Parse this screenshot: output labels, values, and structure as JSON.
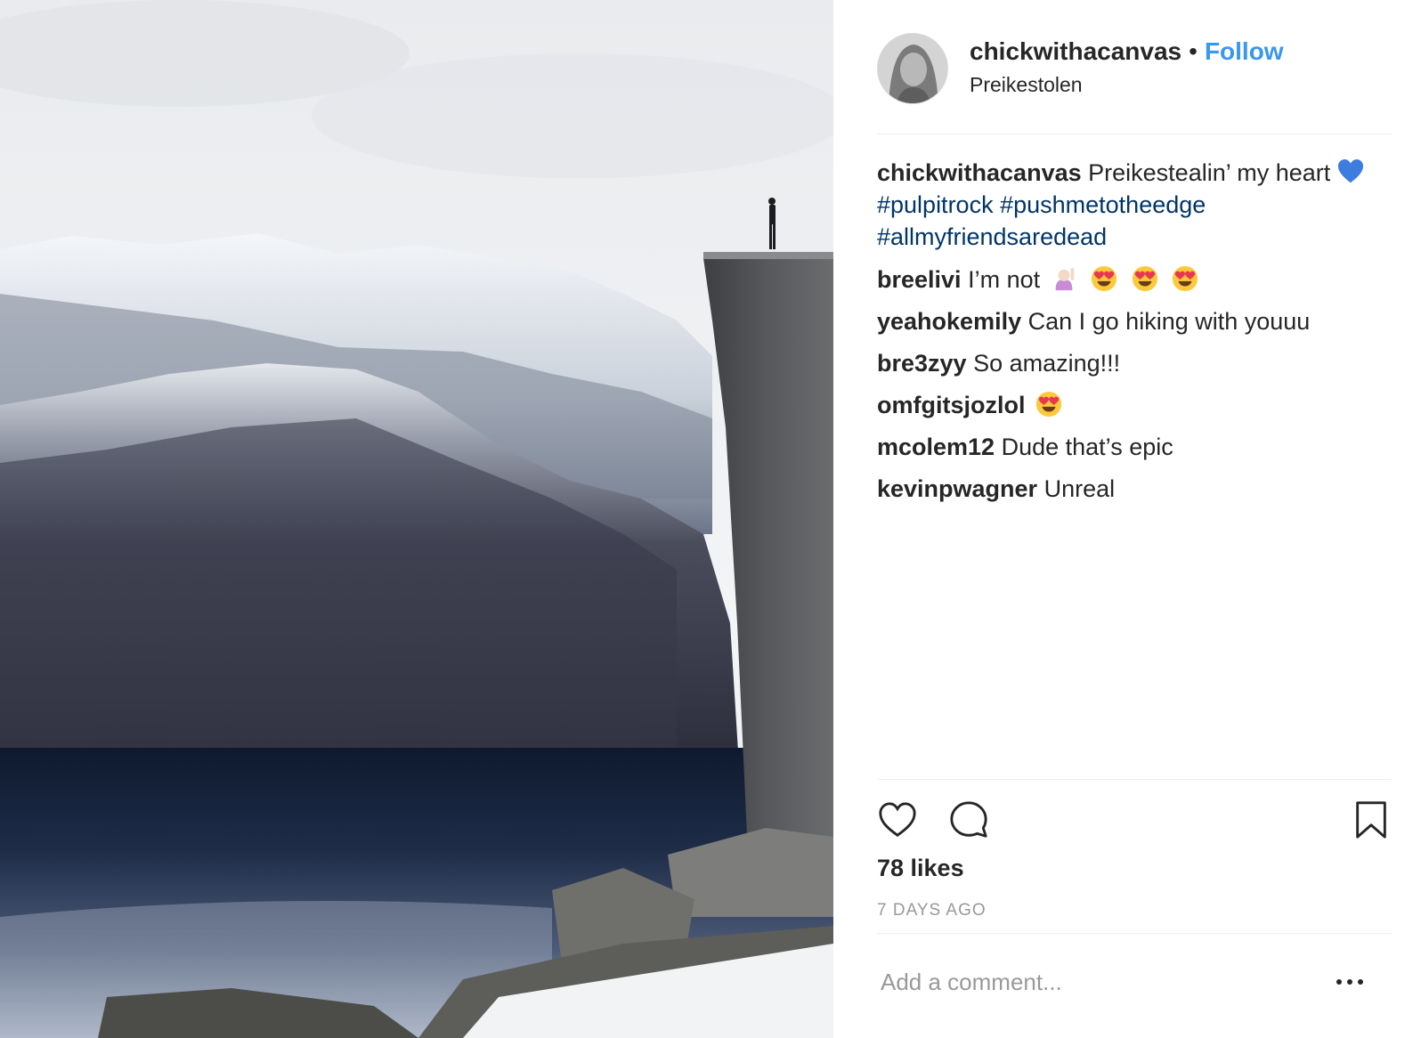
{
  "post": {
    "photo_icon": "landscape-photo",
    "header": {
      "username": "chickwithacanvas",
      "separator": "•",
      "follow_label": "Follow",
      "location": "Preikestolen"
    },
    "caption": {
      "username": "chickwithacanvas",
      "text": "Preikestealin’ my heart",
      "emoji_icon": "blue-heart",
      "hashtags": [
        "#pulpitrock",
        "#pushmetotheedge",
        "#allmyfriendsaredead"
      ]
    },
    "comments": [
      {
        "username": "breelivi",
        "text": "I’m not",
        "emoji_icons": [
          "woman-raising-hand",
          "heart-eyes",
          "heart-eyes",
          "heart-eyes"
        ]
      },
      {
        "username": "yeahokemily",
        "text": "Can I go hiking with youuu",
        "emoji_icons": []
      },
      {
        "username": "bre3zyy",
        "text": "So amazing!!!",
        "emoji_icons": []
      },
      {
        "username": "omfgitsjozlol",
        "text": "",
        "emoji_icons": [
          "heart-eyes"
        ]
      },
      {
        "username": "mcolem12",
        "text": "Dude that’s epic",
        "emoji_icons": []
      },
      {
        "username": "kevinpwagner",
        "text": "Unreal",
        "emoji_icons": []
      }
    ],
    "actions": {
      "like_icon": "heart-outline",
      "comment_icon": "speech-bubble",
      "save_icon": "bookmark"
    },
    "likes": "78 likes",
    "time_ago": "7 DAYS AGO",
    "add_comment_placeholder": "Add a comment...",
    "more_icon": "ellipsis",
    "colors": {
      "link_blue": "#3897f0",
      "hashtag": "#003569",
      "muted": "#999999",
      "divider": "#efefef",
      "text": "#262626"
    }
  }
}
